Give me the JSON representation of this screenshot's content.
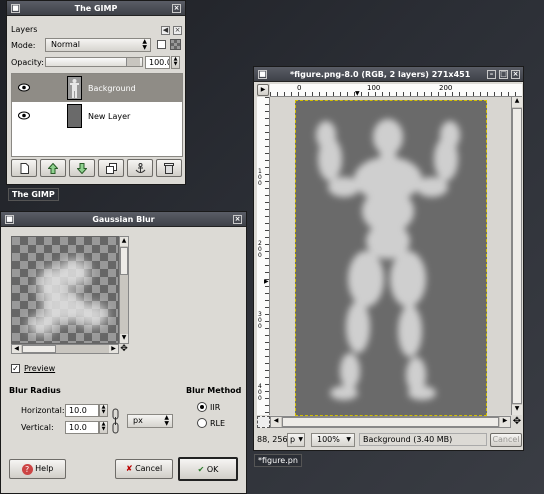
{
  "layers_window": {
    "title": "The GIMP",
    "dock_title": "Layers",
    "mode_label": "Mode:",
    "mode_value": "Normal",
    "opacity_label": "Opacity:",
    "opacity_value": "100.0",
    "layers": [
      {
        "name": "Background",
        "visible": true,
        "selected": true
      },
      {
        "name": "New Layer",
        "visible": true,
        "selected": false
      }
    ],
    "toolbar_icons": [
      "new-layer-icon",
      "raise-layer-icon",
      "lower-layer-icon",
      "duplicate-layer-icon",
      "anchor-layer-icon",
      "delete-layer-icon"
    ]
  },
  "taskbar": {
    "gimp_label": "The GIMP",
    "figure_label": "*figure.pn"
  },
  "blur_dialog": {
    "title": "Gaussian Blur",
    "preview_label": "Preview",
    "preview_checked": true,
    "blur_radius_heading": "Blur Radius",
    "horizontal_label": "Horizontal:",
    "horizontal_value": "10.0",
    "vertical_label": "Vertical:",
    "vertical_value": "10.0",
    "unit_value": "px",
    "blur_method_heading": "Blur Method",
    "method_iir": "IIR",
    "method_rle": "RLE",
    "method_selected": "IIR",
    "help_label": "Help",
    "cancel_label": "Cancel",
    "ok_label": "OK"
  },
  "image_window": {
    "title": "*figure.png-8.0 (RGB, 2 layers) 271x451",
    "ruler_h_labels": [
      "0",
      "100",
      "200"
    ],
    "ruler_v_labels": [
      "1\n0\n0",
      "2\n0\n0",
      "3\n0\n0",
      "4\n0\n0"
    ],
    "coords": "88, 256",
    "unit": "p",
    "zoom": "100%",
    "status": "Background (3.40 MB)",
    "cancel_label": "Cancel"
  },
  "colors": {
    "titlebar": "#4a4d55",
    "desktop": "#2b2e35",
    "canvas_gray": "#6a6a6a",
    "selected_layer": "#8f8c86"
  }
}
